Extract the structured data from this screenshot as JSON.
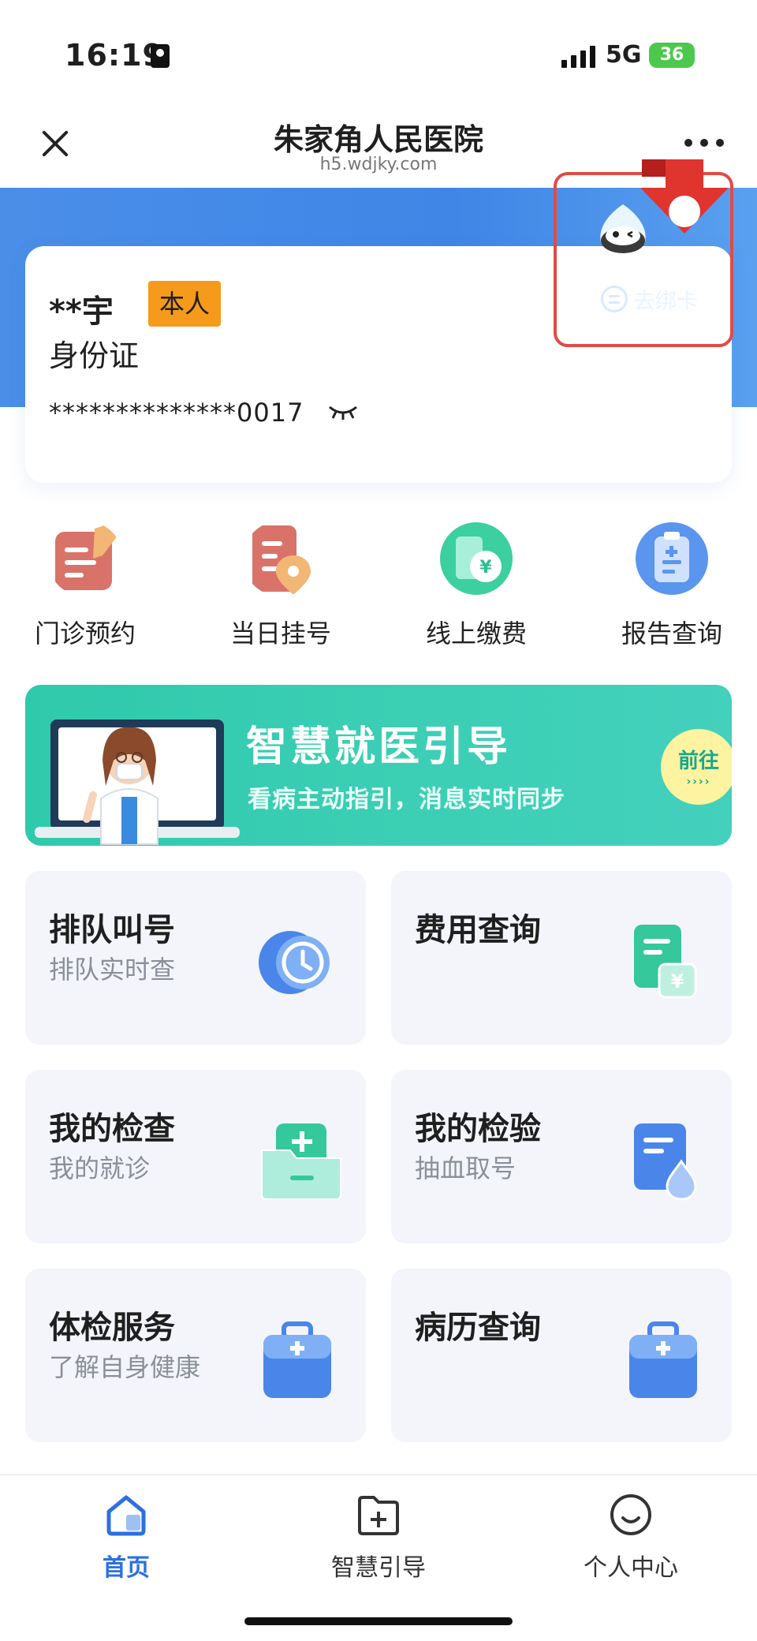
{
  "status_bar": {
    "time": "16:19",
    "network": "5G",
    "battery": "36"
  },
  "nav": {
    "title": "朱家角人民医院",
    "domain": "h5.wdjky.com"
  },
  "patient_card": {
    "name": "**宇",
    "tag": "本人",
    "id_type": "身份证",
    "id_number": "**************0017",
    "bind_label": "去绑卡"
  },
  "quick_entries": [
    {
      "label": "门诊预约",
      "icon": "appointment-icon",
      "color": "#d9736a"
    },
    {
      "label": "当日挂号",
      "icon": "same-day-register-icon",
      "color": "#d9736a"
    },
    {
      "label": "线上缴费",
      "icon": "online-payment-icon",
      "color": "#3ccfa0"
    },
    {
      "label": "报告查询",
      "icon": "report-icon",
      "color": "#5a95ee"
    }
  ],
  "banner": {
    "title": "智慧就医引导",
    "subtitle": "看病主动指引，消息实时同步",
    "go_label": "前往",
    "go_arrows": "››››"
  },
  "tiles": [
    {
      "title": "排队叫号",
      "subtitle": "排队实时查",
      "icon": "queue-clock-icon"
    },
    {
      "title": "费用查询",
      "subtitle": "",
      "icon": "fee-document-icon"
    },
    {
      "title": "我的检查",
      "subtitle": "我的就诊",
      "icon": "exam-folder-icon"
    },
    {
      "title": "我的检验",
      "subtitle": "抽血取号",
      "icon": "lab-test-icon"
    },
    {
      "title": "体检服务",
      "subtitle": "了解自身健康",
      "icon": "checkup-kit-icon"
    },
    {
      "title": "病历查询",
      "subtitle": "",
      "icon": "medical-record-kit-icon"
    }
  ],
  "tabbar": [
    {
      "label": "首页",
      "icon": "home-icon",
      "active": true
    },
    {
      "label": "智慧引导",
      "icon": "folder-plus-icon",
      "active": false
    },
    {
      "label": "个人中心",
      "icon": "smile-icon",
      "active": false
    }
  ],
  "colors": {
    "accent": "#2c6fe0",
    "header_blue": "#4a8ee8",
    "tag_orange": "#f59a1a",
    "banner_teal": "#2fc9ac",
    "annotation_red": "#e04b45"
  }
}
